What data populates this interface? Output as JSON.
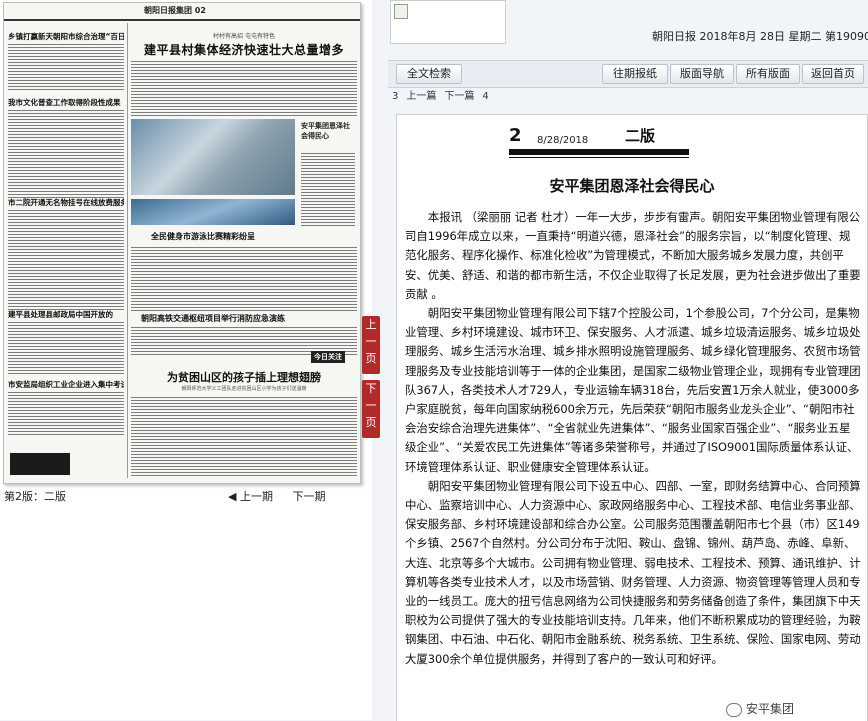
{
  "left_page": {
    "paper_name": "朝阳日报",
    "paper_section": "集团 02",
    "main_subtitle": "村村有高招 屯屯有特色",
    "main_headline": "建平县村集体经济快速壮大总量增多",
    "left_headlines": [
      "乡镇打赢新天朝阳市综合治理“百日行动”",
      "我市文化普查工作取得阶段性成果",
      "市二院开通无名物挂号在线放费服务",
      "建平县处理县邮政局中国开放的",
      "市安监局组织工业企业进入集中考试"
    ],
    "side_text": "安平集团恩泽社会得民心",
    "photo_caption": "全民健身市游泳比赛精彩纷呈",
    "mid_headline": "朝阳高铁交通枢纽项目举行消防应急演练",
    "stamp_text": "今日关注",
    "bottom_headline": "为贫困山区的孩子插上理想翅膀",
    "bottom_sub": "朝阳师范大学义工团队走进贫困山区小学为孩子们送温暖",
    "logo_text": "安平集团",
    "page_label": "第2版：二版",
    "prev_page": "上一期",
    "next_page": "下一期",
    "tab_prev": "上一页",
    "tab_next": "下一页"
  },
  "header": {
    "dateline": "朝阳日报  2018年8月 28日 星期二  第19090期"
  },
  "toolbar": {
    "search": "全文检索",
    "past": "往期报纸",
    "nav": "版面导航",
    "all": "所有版面",
    "home": "返回首页"
  },
  "article_nav": {
    "n1": "3",
    "prev": "上一篇",
    "next": "下一篇",
    "n2": "4"
  },
  "article": {
    "page_num": "2",
    "date": "8/28/2018",
    "banner": "二版",
    "title": "安平集团恩泽社会得民心",
    "paragraphs": [
      "本报讯 （梁丽丽 记者 杜才）一年一大步，步步有雷声。朝阳安平集团物业管理有限公司自1996年成立以来，一直秉持“明道兴德，恩泽社会”的服务宗旨，以“制度化管理、规范化服务、程序化操作、标准化检收”为管理模式，不断加大服务城乡发展力度，共创平安、优美、舒适、和谐的都市新生活，不仅企业取得了长足发展，更为社会进步做出了重要贡献 。",
      "朝阳安平集团物业管理有限公司下辖7个控股公司，1个参股公司，7个分公司，是集物业管理、乡村环境建设、城市环卫、保安服务、人才派遣、城乡垃圾清运服务、城乡垃圾处理服务、城乡生活污水治理、城乡排水照明设施管理服务、城乡绿化管理服务、农贸市场管理服务及专业技能培训等于一体的企业集团，是国家二级物业管理企业，现拥有专业管理团队367人，各类技术人才729人，专业运输车辆318台，先后安置1万余人就业，使3000多户家庭脱贫，每年向国家纳税600余万元，先后荣获“朝阳市服务业龙头企业”、“朝阳市社会治安综合治理先进集体”、“全省就业先进集体”、“服务业国家百强企业”、“服务业五星级企业”、“关爱农民工先进集体”等诸多荣誉称号，并通过了ISO9001国际质量体系认证、环境管理体系认证、职业健康安全管理体系认证。",
      "朝阳安平集团物业管理有限公司下设五中心、四部、一室，即财务结算中心、合同预算中心、监察培训中心、人力资源中心、家政网络服务中心、工程技术部、电信业务事业部、保安服务部、乡村环境建设部和综合办公室。公司服务范围覆盖朝阳市七个县（市）区149个乡镇、2567个自然村。分公司分布于沈阳、鞍山、盘锦、锦州、葫芦岛、赤峰、阜新、大连、北京等多个大城市。公司拥有物业管理、弱电技术、工程技术、预算、通讯维护、计算机等各类专业技术人才，以及市场营销、财务管理、人力资源、物资管理等管理人员和专业的一线员工。庞大的扭亏信息网络为公司快捷服务和劳务储备创造了条件，集团旗下中天职校为公司提供了强大的专业技能培训支持。几年来，他们不断积累成功的管理经验，为鞍钢集团、中石油、中石化、朝阳市金融系统、税务系统、卫生系统、保险、国家电网、劳动大厦300余个单位提供服务，并得到了客户的一致认可和好评。"
    ]
  },
  "watermark": "安平集团"
}
